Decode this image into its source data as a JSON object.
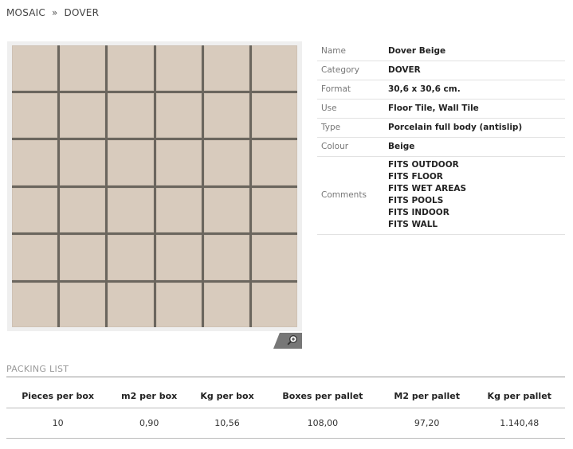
{
  "breadcrumb": {
    "parent": "MOSAIC",
    "separator": "»",
    "current": "DOVER"
  },
  "product_image": {
    "tile_color": "#d8cbbd",
    "grout_color": "#6b665e",
    "rows": 6,
    "cols": 6
  },
  "zoom_icon": "magnifier-plus-icon",
  "specs": {
    "name_label": "Name",
    "name_value": "Dover Beige",
    "category_label": "Category",
    "category_value": "DOVER",
    "format_label": "Format",
    "format_value": "30,6 x 30,6 cm.",
    "use_label": "Use",
    "use_value": "Floor Tile, Wall Tile",
    "type_label": "Type",
    "type_value": "Porcelain full body (antislip)",
    "colour_label": "Colour",
    "colour_value": "Beige",
    "comments_label": "Comments",
    "comments": [
      "FITS OUTDOOR",
      "FITS FLOOR",
      "FITS WET AREAS",
      "FITS POOLS",
      "FITS INDOOR",
      "FITS WALL"
    ]
  },
  "packing": {
    "title": "PACKING LIST",
    "headers": [
      "Pieces per box",
      "m2 per box",
      "Kg per box",
      "Boxes per pallet",
      "M2 per pallet",
      "Kg per pallet"
    ],
    "values": [
      "10",
      "0,90",
      "10,56",
      "108,00",
      "97,20",
      "1.140,48"
    ]
  }
}
